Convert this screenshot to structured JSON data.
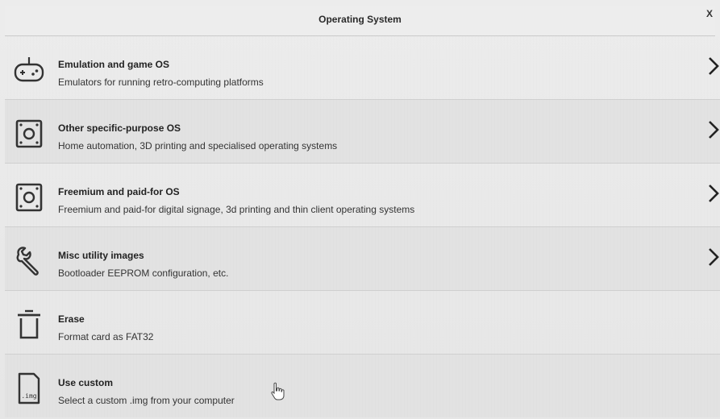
{
  "dialog": {
    "title": "Operating System",
    "close_label": "X"
  },
  "items": [
    {
      "title": "Emulation and game OS",
      "description": "Emulators for running retro-computing platforms",
      "icon": "gamepad-icon",
      "has_chevron": true
    },
    {
      "title": "Other specific-purpose OS",
      "description": "Home automation, 3D printing and specialised operating systems",
      "icon": "device-box-icon",
      "has_chevron": true
    },
    {
      "title": "Freemium and paid-for OS",
      "description": "Freemium and paid-for digital signage, 3d printing and thin client operating systems",
      "icon": "device-box-icon",
      "has_chevron": true
    },
    {
      "title": "Misc utility images",
      "description": "Bootloader EEPROM configuration, etc.",
      "icon": "wrench-icon",
      "has_chevron": true
    },
    {
      "title": "Erase",
      "description": "Format card as FAT32",
      "icon": "trash-icon",
      "has_chevron": false
    },
    {
      "title": "Use custom",
      "description": "Select a custom .img from your computer",
      "icon": "img-file-icon",
      "icon_label": ".img",
      "has_chevron": false
    }
  ]
}
